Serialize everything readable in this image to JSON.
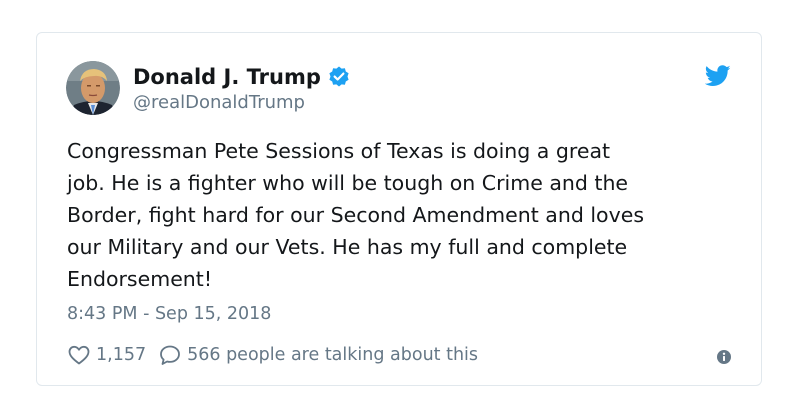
{
  "author": {
    "display_name": "Donald J. Trump",
    "handle": "@realDonaldTrump",
    "verified_icon": "verified-badge-icon",
    "avatar": "profile-photo"
  },
  "tweet": {
    "text_lines": [
      "Congressman Pete Sessions of Texas is doing a great",
      "job. He is a fighter who will be tough on Crime and the",
      "Border, fight hard for our Second Amendment and loves",
      "our Military and our Vets. He has my full and complete",
      "Endorsement!"
    ],
    "timestamp": "8:43 PM - Sep 15, 2018"
  },
  "engagement": {
    "likes": "1,157",
    "talking": "566 people are talking about this"
  },
  "colors": {
    "brand_blue": "#1da1f2",
    "text_primary": "#14171a",
    "text_secondary": "#657786",
    "border": "#e1e8ed"
  },
  "icons": {
    "brand": "twitter-bird-icon",
    "like": "heart-icon",
    "reply": "speech-bubble-icon",
    "info": "info-icon"
  }
}
